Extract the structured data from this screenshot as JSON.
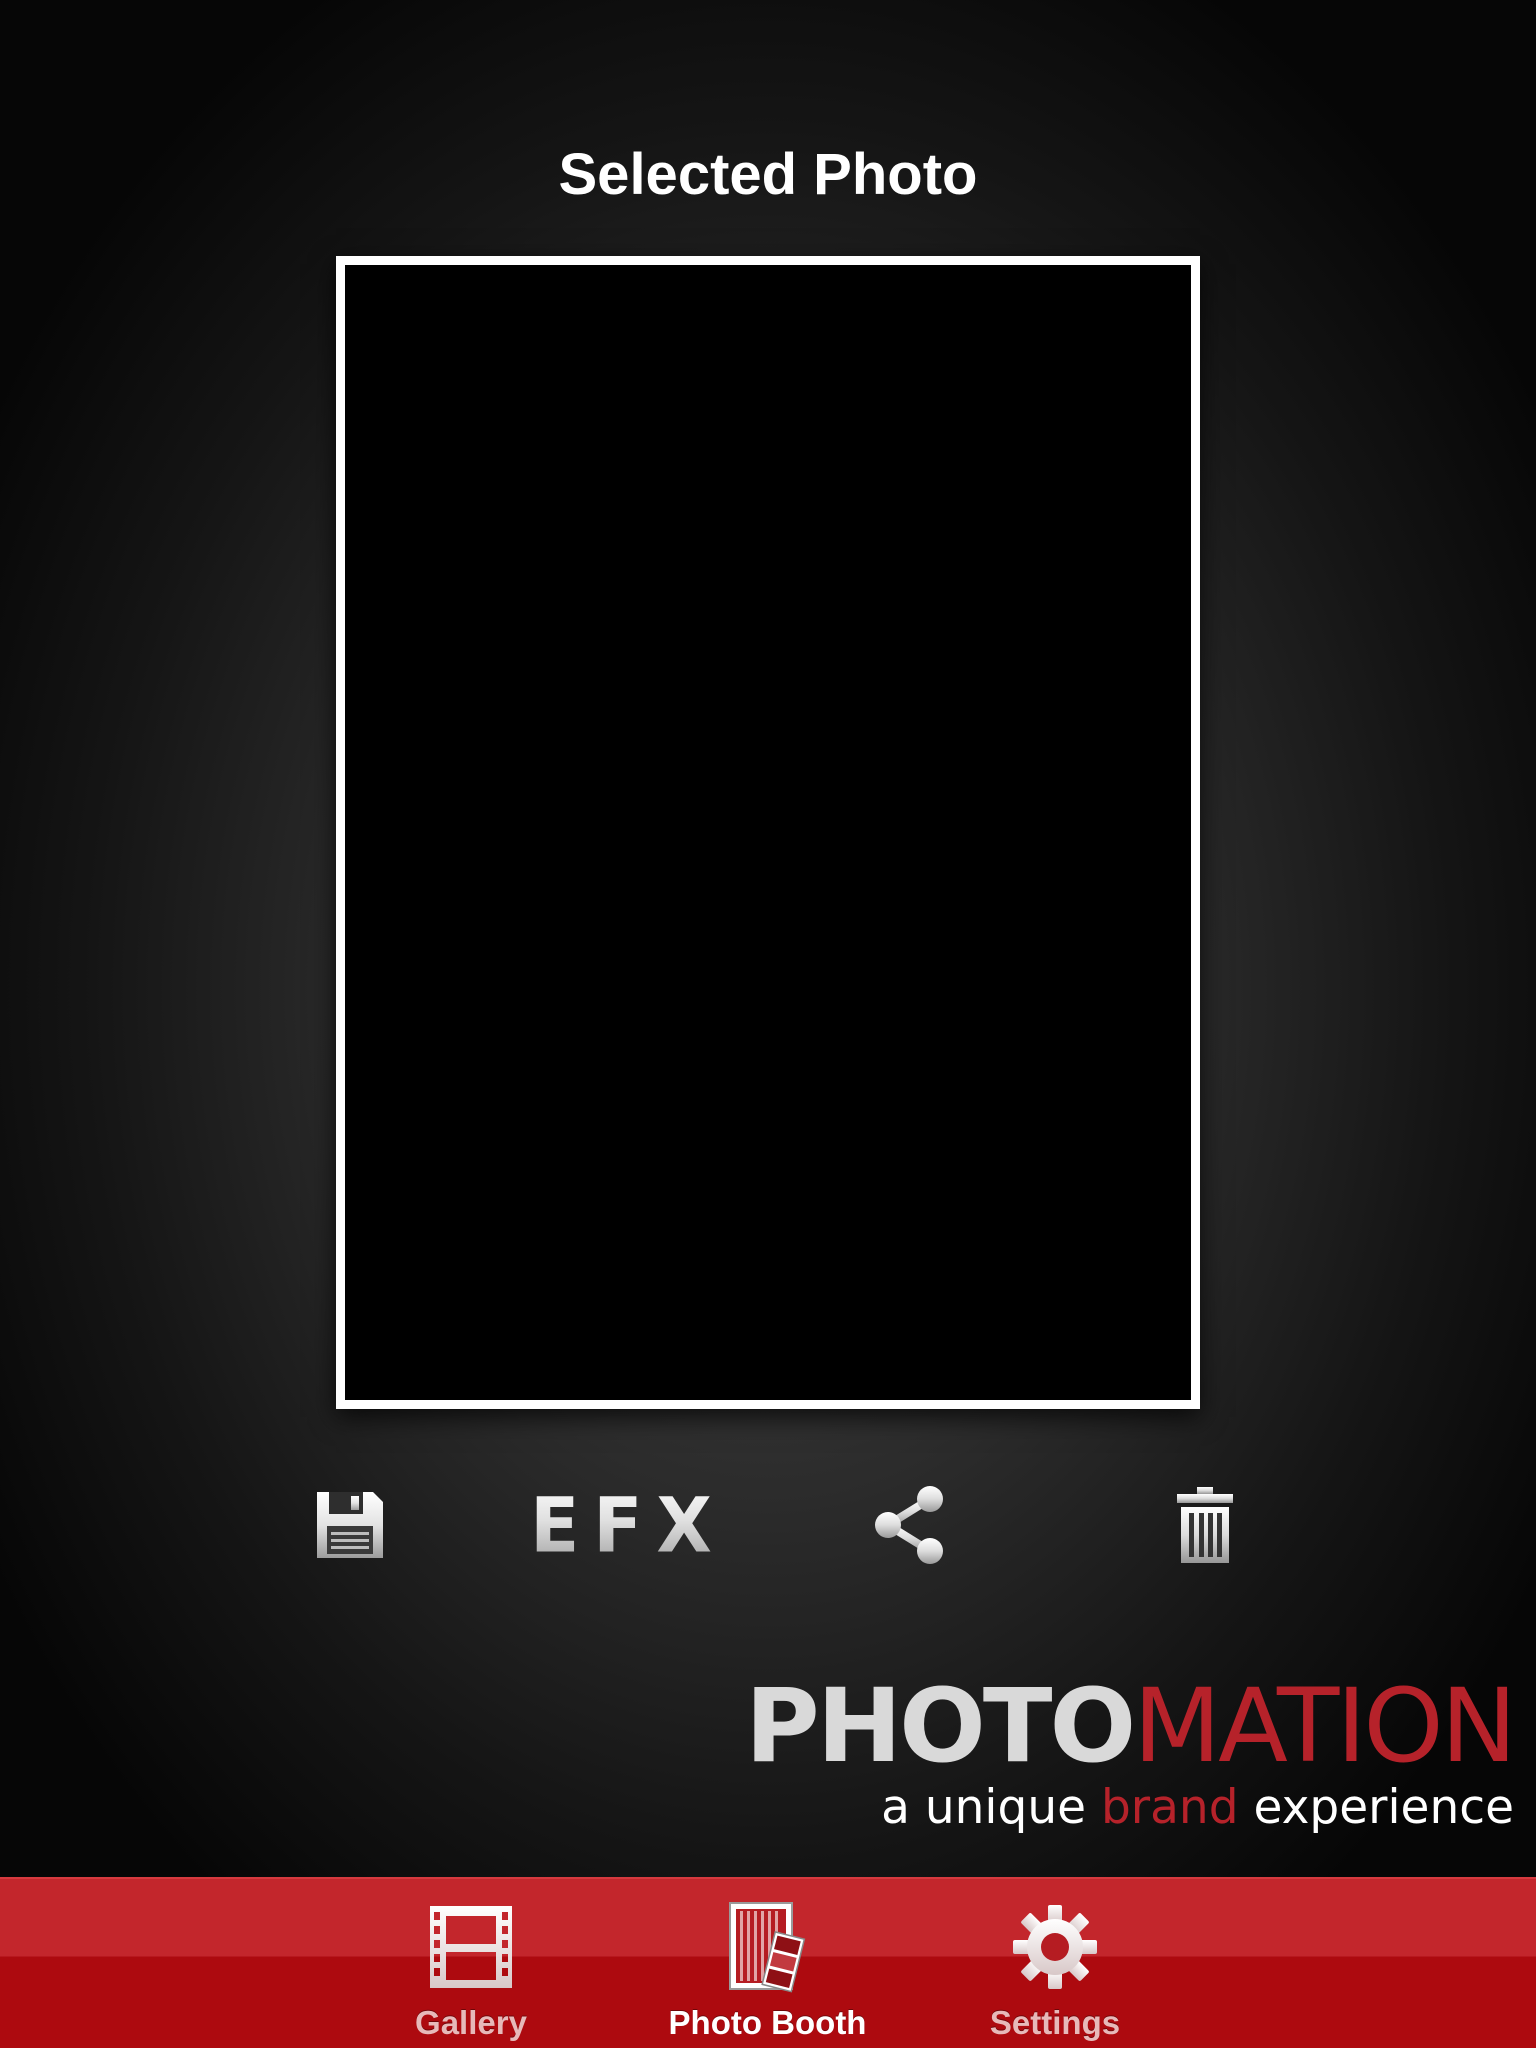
{
  "header": {
    "title": "Selected Photo"
  },
  "photo": {
    "frame_color": "#ffffff",
    "content_color": "#000000"
  },
  "actions": {
    "save_icon": "floppy-disk-icon",
    "efx_label": "EFX",
    "share_icon": "share-icon",
    "delete_icon": "trash-icon"
  },
  "brand": {
    "logo_part1": "PHOTO",
    "logo_part2": "MATION",
    "tagline_pre": "a unique ",
    "tagline_accent": "brand",
    "tagline_post": " experience",
    "accent_color": "#b6222a"
  },
  "tabbar": {
    "background_color": "#c3262c",
    "tabs": [
      {
        "label": "Gallery",
        "icon": "film-strip-icon",
        "active": false
      },
      {
        "label": "Photo Booth",
        "icon": "photo-booth-icon",
        "active": true
      },
      {
        "label": "Settings",
        "icon": "gear-icon",
        "active": false
      }
    ]
  }
}
